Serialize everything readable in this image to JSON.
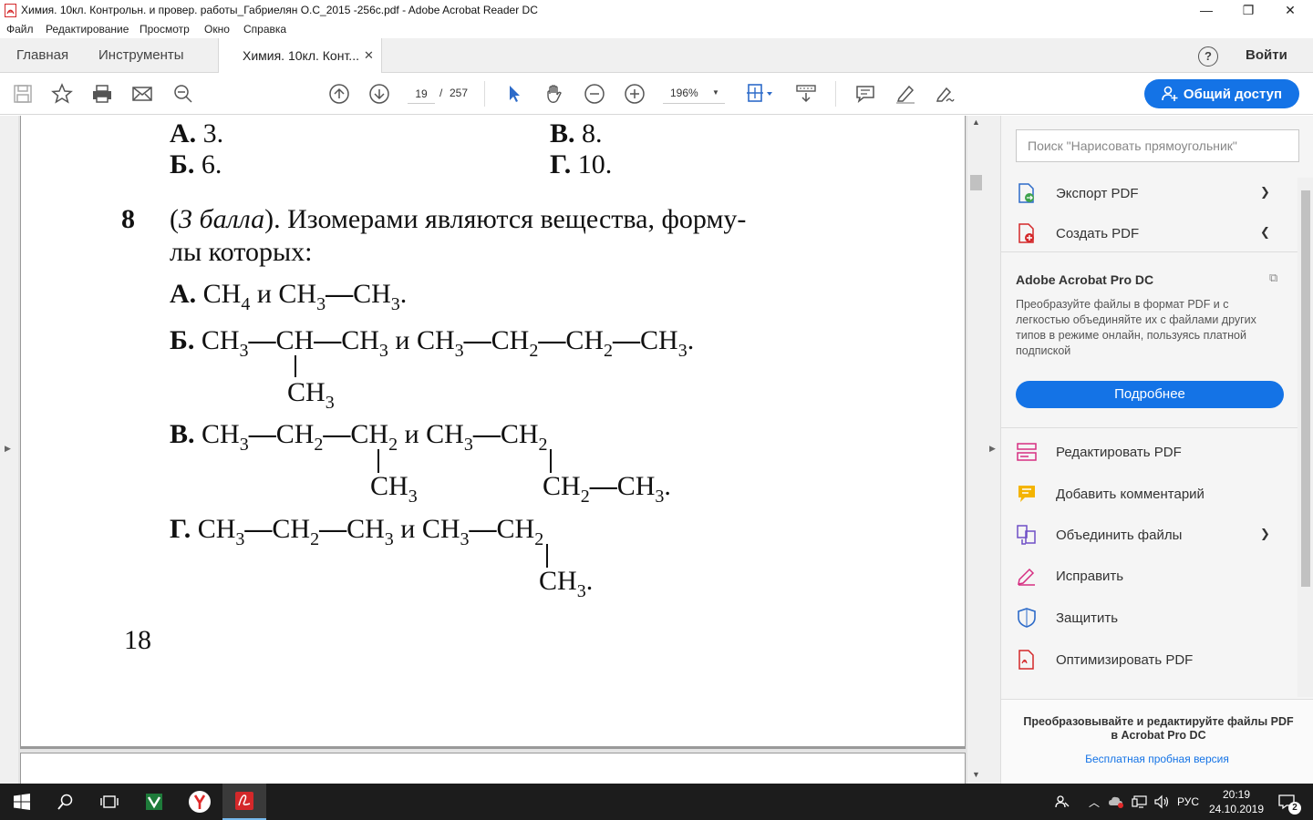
{
  "window": {
    "title": "Химия. 10кл. Контрольн. и провер. работы_Габриелян О.С_2015 -256с.pdf - Adobe Acrobat Reader DC",
    "minimize": "—",
    "maximize": "❐",
    "close": "✕"
  },
  "menu": [
    {
      "label": "Файл"
    },
    {
      "label": "Редактирование"
    },
    {
      "label": "Просмотр"
    },
    {
      "label": "Окно"
    },
    {
      "label": "Справка"
    }
  ],
  "tabs": {
    "home": "Главная",
    "tools": "Инструменты",
    "document": "Химия. 10кл. Конт...",
    "close": "✕",
    "help": "?",
    "login": "Войти"
  },
  "toolbar": {
    "page_current": "19",
    "page_sep": "/",
    "page_total": "257",
    "zoom": "196%",
    "share": "Общий доступ"
  },
  "document": {
    "prev_answers": {
      "a": "А.",
      "a_val": "3.",
      "b": "Б.",
      "b_val": "6.",
      "v": "В.",
      "v_val": "8.",
      "g": "Г.",
      "g_val": "10."
    },
    "q_num": "8",
    "q_points": "3 балла",
    "q_text1": "). Изомерами являются вещества, форму-",
    "q_text2": "лы которых:",
    "opt_a": "А.",
    "opt_b": "Б.",
    "opt_v": "В.",
    "opt_g": "Г.",
    "and": "и",
    "page_number": "18"
  },
  "right_panel": {
    "search_placeholder": "Поиск \"Нарисовать прямоугольник\"",
    "export_pdf": "Экспорт PDF",
    "create_pdf": "Создать PDF",
    "promo_title": "Adobe Acrobat Pro DC",
    "promo_desc": "Преобразуйте файлы в формат PDF и с легкостью объединяйте их с файлами других типов в режиме онлайн, пользуясь платной подпиской",
    "promo_button": "Подробнее",
    "edit_pdf": "Редактировать PDF",
    "add_comment": "Добавить комментарий",
    "combine_files": "Объединить файлы",
    "fix": "Исправить",
    "protect": "Защитить",
    "optimize_pdf": "Оптимизировать PDF",
    "footer_text": "Преобразовывайте и редактируйте файлы PDF в Acrobat Pro DC",
    "footer_link": "Бесплатная пробная версия"
  },
  "taskbar": {
    "lang": "РУС",
    "time": "20:19",
    "date": "24.10.2019",
    "notification_count": "2"
  },
  "colors": {
    "accent": "#1473e6",
    "taskbar": "#1c1c1c"
  }
}
